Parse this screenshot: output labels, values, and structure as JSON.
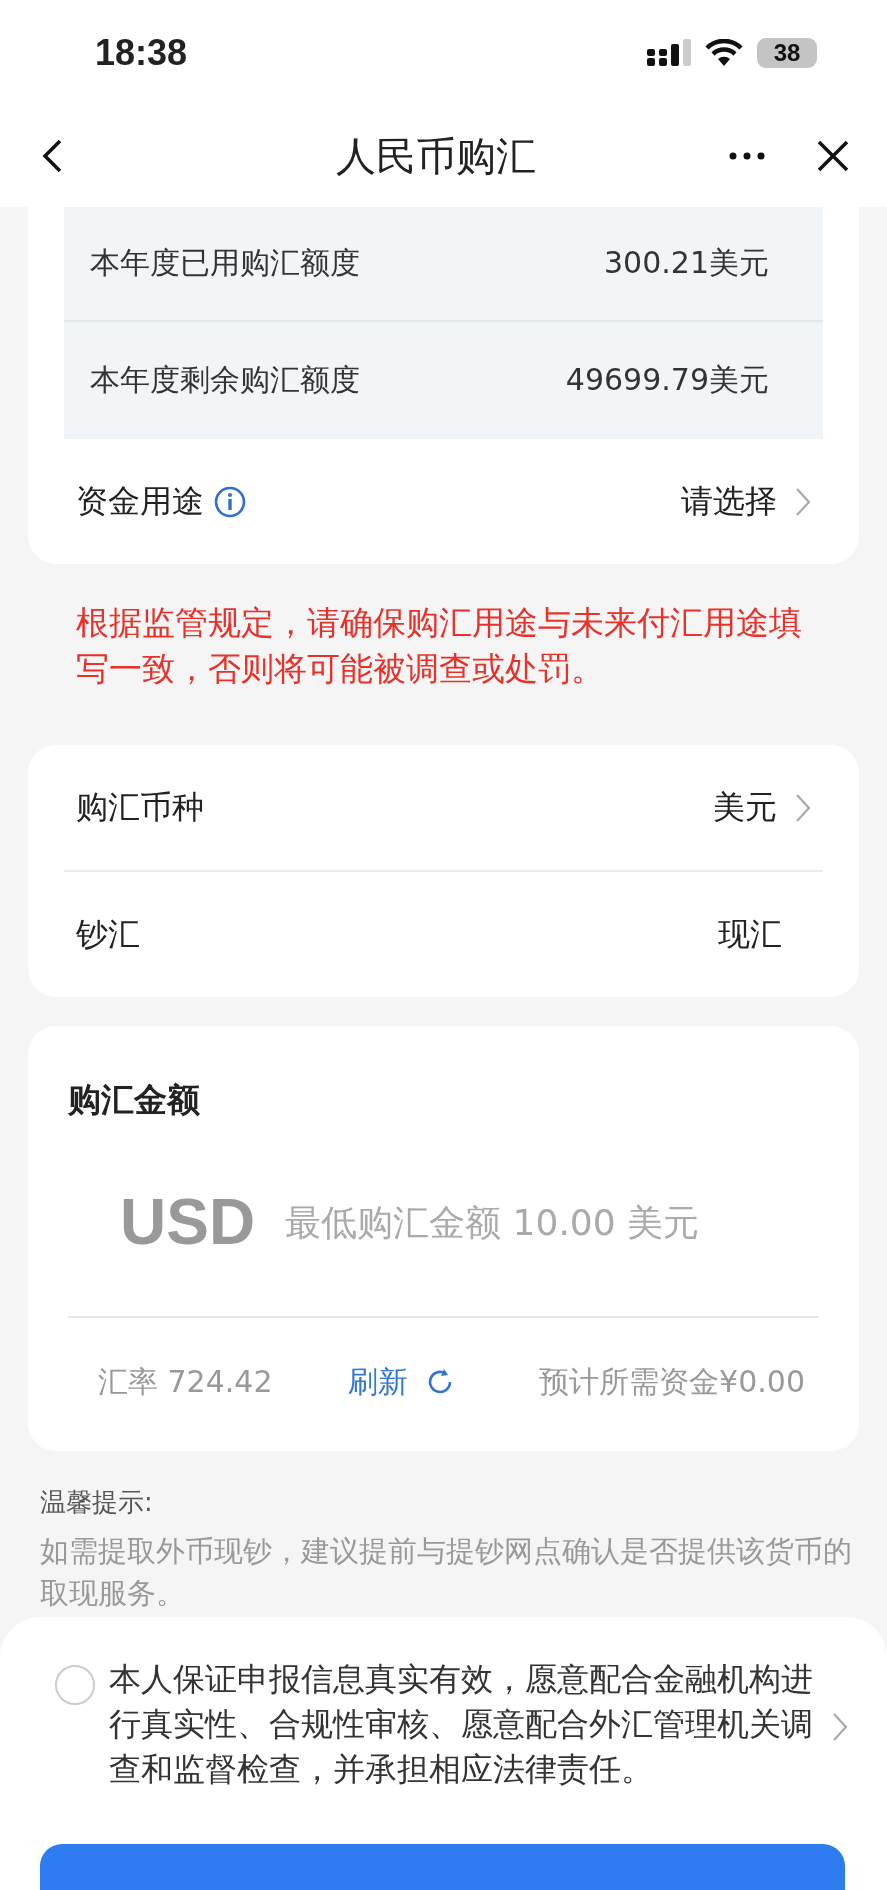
{
  "status_bar": {
    "time": "18:38",
    "battery": "38"
  },
  "nav": {
    "title": "人民币购汇"
  },
  "quota_rows": [
    {
      "label": "本年度已用购汇额度",
      "value": "300.21美元"
    },
    {
      "label": "本年度剩余购汇额度",
      "value": "49699.79美元"
    }
  ],
  "purpose": {
    "label": "资金用途",
    "value": "请选择"
  },
  "warning": "根据监管规定，请确保购汇用途与未来付汇用途填写一致，否则将可能被调查或处罚。",
  "currency_rows": [
    {
      "kind": "select",
      "label": "购汇币种",
      "value": "美元"
    },
    {
      "kind": "static",
      "label": "钞汇",
      "value": "现汇"
    }
  ],
  "amount": {
    "title": "购汇金额",
    "currency": "USD",
    "placeholder": "最低购汇金额 10.00 美元",
    "rate": "汇率 724.42",
    "refresh": "刷新",
    "estimate": "预计所需资金¥0.00"
  },
  "tips": {
    "title": "温馨提示:",
    "text": "如需提取外币现钞，建议提前与提钞网点确认是否提供该货币的取现服务。"
  },
  "agreement": {
    "checked": false,
    "text": "本人保证申报信息真实有效，愿意配合金融机构进行真实性、合规性审核、愿意配合外汇管理机关调查和监督检查，并承担相应法律责任。"
  }
}
